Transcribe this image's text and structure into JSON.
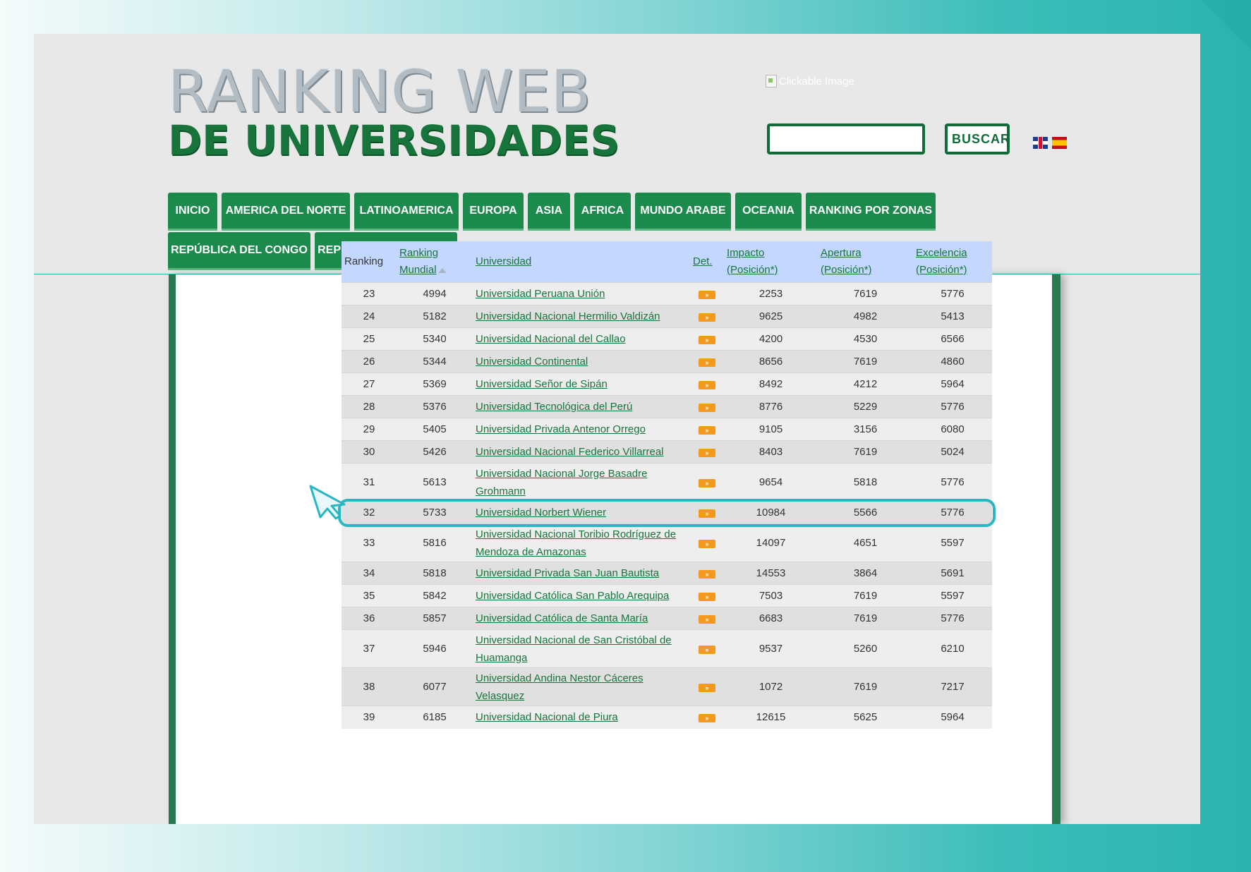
{
  "logo": {
    "line1": "RANKING WEB",
    "line2": "DE UNIVERSIDADES"
  },
  "header": {
    "clickable_image_alt": "Clickable Image"
  },
  "search": {
    "placeholder": "",
    "button_label": "BUSCAR"
  },
  "flags": [
    {
      "icon": "uk-flag-icon"
    },
    {
      "icon": "spain-flag-icon"
    }
  ],
  "nav": {
    "tabs": [
      "INICIO",
      "AMERICA DEL NORTE",
      "LATINOAMERICA",
      "EUROPA",
      "ASIA",
      "AFRICA",
      "MUNDO ARABE",
      "OCEANIA",
      "RANKING POR ZONAS",
      "REPÚBLICA DEL CONGO",
      "REPÚBLICA DEL CONGO"
    ]
  },
  "table": {
    "headers": {
      "ranking": "Ranking",
      "mundial_1": "Ranking",
      "mundial_2": "Mundial",
      "universidad": "Universidad",
      "det": "Det.",
      "impacto_1": "Impacto",
      "impacto_2": "(Posición*)",
      "apertura_1": "Apertura",
      "apertura_2": "(Posición*)",
      "excelencia_1": "Excelencia",
      "excelencia_2": "(Posición*)"
    },
    "det_label": "»",
    "rows": [
      {
        "rank": "23",
        "world": "4994",
        "name": "Universidad Peruana Unión",
        "impacto": "2253",
        "apertura": "7619",
        "excelencia": "5776"
      },
      {
        "rank": "24",
        "world": "5182",
        "name": "Universidad Nacional Hermilio Valdizán",
        "impacto": "9625",
        "apertura": "4982",
        "excelencia": "5413"
      },
      {
        "rank": "25",
        "world": "5340",
        "name": "Universidad Nacional del Callao",
        "impacto": "4200",
        "apertura": "4530",
        "excelencia": "6566"
      },
      {
        "rank": "26",
        "world": "5344",
        "name": "Universidad Continental",
        "impacto": "8656",
        "apertura": "7619",
        "excelencia": "4860"
      },
      {
        "rank": "27",
        "world": "5369",
        "name": "Universidad Señor de Sipán",
        "impacto": "8492",
        "apertura": "4212",
        "excelencia": "5964"
      },
      {
        "rank": "28",
        "world": "5376",
        "name": "Universidad Tecnológica del Perú",
        "impacto": "8776",
        "apertura": "5229",
        "excelencia": "5776"
      },
      {
        "rank": "29",
        "world": "5405",
        "name": "Universidad Privada Antenor Orrego",
        "impacto": "9105",
        "apertura": "3156",
        "excelencia": "6080"
      },
      {
        "rank": "30",
        "world": "5426",
        "name": "Universidad Nacional Federico Villarreal",
        "impacto": "8403",
        "apertura": "7619",
        "excelencia": "5024"
      },
      {
        "rank": "31",
        "world": "5613",
        "name": "Universidad Nacional Jorge Basadre Grohmann",
        "impacto": "9654",
        "apertura": "5818",
        "excelencia": "5776"
      },
      {
        "rank": "32",
        "world": "5733",
        "name": "Universidad Norbert Wiener",
        "impacto": "10984",
        "apertura": "5566",
        "excelencia": "5776"
      },
      {
        "rank": "33",
        "world": "5816",
        "name": "Universidad Nacional Toribio Rodríguez de Mendoza de Amazonas",
        "impacto": "14097",
        "apertura": "4651",
        "excelencia": "5597"
      },
      {
        "rank": "34",
        "world": "5818",
        "name": "Universidad Privada San Juan Bautista",
        "impacto": "14553",
        "apertura": "3864",
        "excelencia": "5691"
      },
      {
        "rank": "35",
        "world": "5842",
        "name": "Universidad Católica San Pablo Arequipa",
        "impacto": "7503",
        "apertura": "7619",
        "excelencia": "5597"
      },
      {
        "rank": "36",
        "world": "5857",
        "name": "Universidad Católica de Santa María",
        "impacto": "6683",
        "apertura": "7619",
        "excelencia": "5776"
      },
      {
        "rank": "37",
        "world": "5946",
        "name": "Universidad Nacional de San Cristóbal de Huamanga",
        "impacto": "9537",
        "apertura": "5260",
        "excelencia": "6210"
      },
      {
        "rank": "38",
        "world": "6077",
        "name": "Universidad Andina Nestor Cáceres Velasquez",
        "impacto": "1072",
        "apertura": "7619",
        "excelencia": "7217"
      },
      {
        "rank": "39",
        "world": "6185",
        "name": "Universidad Nacional de Piura",
        "impacto": "12615",
        "apertura": "5625",
        "excelencia": "5964"
      }
    ]
  },
  "colors": {
    "brand_green": "#17753c",
    "tab_green": "#1b8a4c",
    "highlight": "#27b8c4",
    "header_blue": "#c4d8ff"
  }
}
